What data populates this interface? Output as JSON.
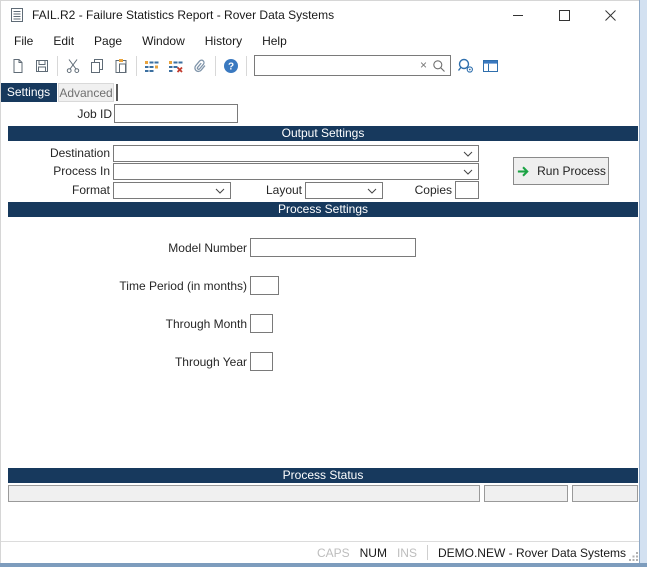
{
  "window": {
    "title": "FAIL.R2 - Failure Statistics Report - Rover Data Systems",
    "controls": {
      "minimize": "minimize",
      "maximize": "maximize",
      "close": "close"
    }
  },
  "menu": {
    "items": [
      "File",
      "Edit",
      "Page",
      "Window",
      "History",
      "Help"
    ]
  },
  "toolbar": {
    "search": {
      "value": "",
      "placeholder": "",
      "clear_glyph": "×"
    },
    "icon_names": [
      "new-document",
      "save",
      "cut",
      "copy",
      "paste",
      "insert-rows",
      "delete-rows",
      "attachment",
      "help",
      "search-clear",
      "search-magnifier",
      "advanced-lookup",
      "panel-layout"
    ]
  },
  "tabs": [
    {
      "label": "Settings",
      "active": true
    },
    {
      "label": "Advanced",
      "active": false
    }
  ],
  "form": {
    "job_id_label": "Job ID",
    "job_id_value": "",
    "output_settings": {
      "header": "Output Settings",
      "destination_label": "Destination",
      "destination_value": "",
      "process_in_label": "Process In",
      "process_in_value": "",
      "format_label": "Format",
      "format_value": "",
      "layout_label": "Layout",
      "layout_value": "",
      "copies_label": "Copies",
      "copies_value": "",
      "run_button_label": "Run Process"
    },
    "process_settings": {
      "header": "Process Settings",
      "model_number_label": "Model Number",
      "model_number_value": "",
      "time_period_label": "Time Period (in months)",
      "time_period_value": "",
      "through_month_label": "Through Month",
      "through_month_value": "",
      "through_year_label": "Through Year",
      "through_year_value": ""
    },
    "process_status": {
      "header": "Process Status",
      "fields": [
        "",
        "",
        ""
      ]
    }
  },
  "status_bar": {
    "caps": "CAPS",
    "num": "NUM",
    "ins": "INS",
    "session": "DEMO.NEW - Rover Data Systems"
  },
  "colors": {
    "navy_header": "#17395d",
    "icon_blue": "#2f6fad",
    "icon_orange": "#e8a33d",
    "icon_red": "#c23b2e",
    "run_arrow_green": "#1ba344",
    "window_frame_blue": "#7d9cbd"
  }
}
